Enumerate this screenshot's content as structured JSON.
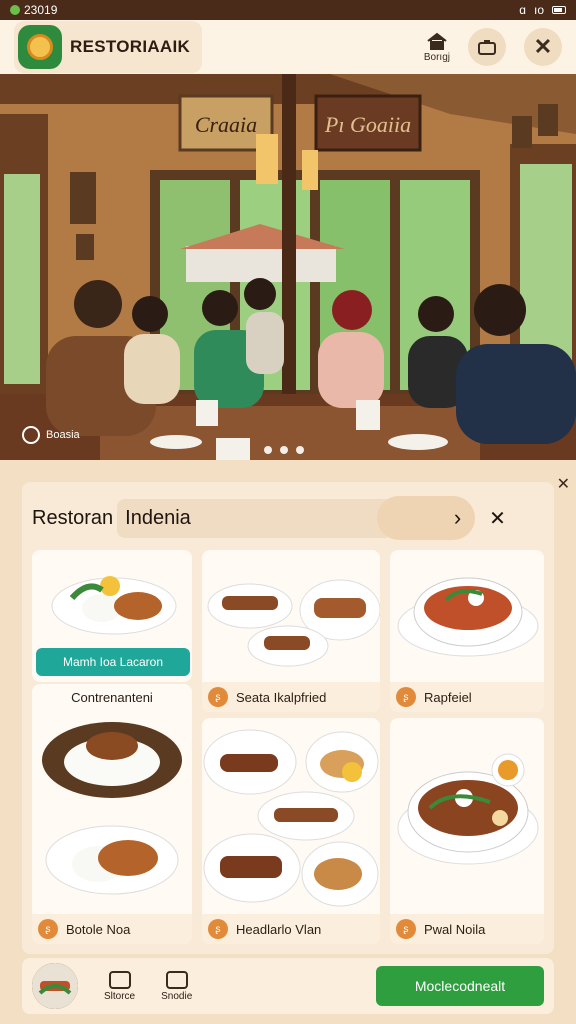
{
  "status": {
    "time": "23019",
    "icons_text": "ıo",
    "right_glyph": "ɑ"
  },
  "app": {
    "name": "RESTORIAAIK",
    "home_label": "Borıgj"
  },
  "icons": {
    "logo": "sun-flower-icon",
    "home": "home-icon",
    "camera": "camera-icon",
    "close": "close-icon",
    "chevron": "chevron-right-icon"
  },
  "hero": {
    "sign_left": "Craaia",
    "sign_right": "Pı Goaiia",
    "caption": "Boasia",
    "slide_count": 3
  },
  "panel": {
    "title": "Restoran",
    "title_highlight": "Indenia",
    "chevron": "›",
    "close": "✕"
  },
  "cards": [
    {
      "label": "Mamh Ioa Lacaron",
      "type": "button"
    },
    {
      "label": "Seata Ikalpfried",
      "bullet": "ʂ"
    },
    {
      "label": "Rapfeiel",
      "bullet": "ʂ"
    },
    {
      "label": "Contrenanteni",
      "type": "header"
    },
    {
      "label": "Botole Noa",
      "bullet": "ʂ"
    },
    {
      "label": "Headlarlo Vlan",
      "bullet": "ʂ"
    },
    {
      "label": "Pwal Noila",
      "bullet": "ʂ"
    }
  ],
  "bottom": {
    "nav": [
      {
        "label": "Sltorce"
      },
      {
        "label": "Snodie"
      }
    ],
    "cta": "Moclecodnealt"
  },
  "colors": {
    "accent": "#1fa89a",
    "cta": "#2f9e3f",
    "bullet": "#e08a3a",
    "header_bg": "#fdf3e4"
  }
}
